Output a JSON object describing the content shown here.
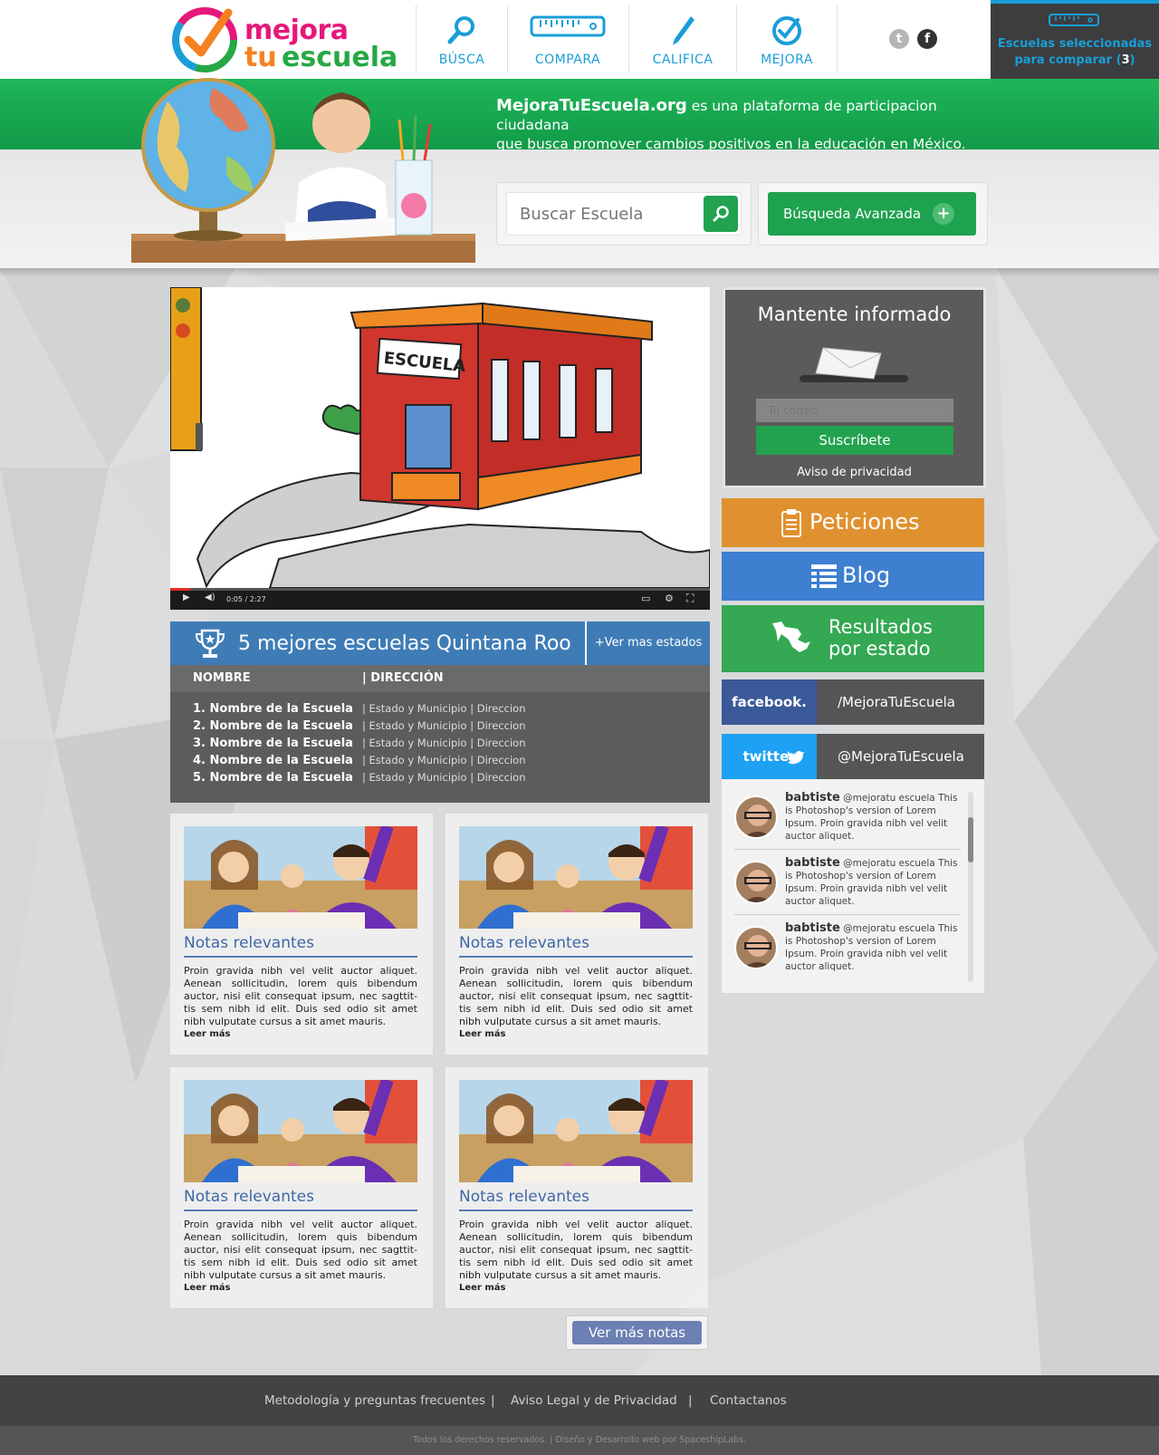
{
  "header": {
    "logo_line1": "mejora",
    "logo_line2a": "tu",
    "logo_line2b": "escuela",
    "nav": [
      {
        "label": "BÚSCA",
        "icon": "magnifier-icon"
      },
      {
        "label": "COMPARA",
        "icon": "ruler-icon"
      },
      {
        "label": "CALIFICA",
        "icon": "pencil-icon"
      },
      {
        "label": "MEJORA",
        "icon": "checkmark-icon"
      }
    ],
    "social": [
      {
        "icon": "twitter-icon",
        "glyph": "t"
      },
      {
        "icon": "facebook-icon",
        "glyph": "f"
      }
    ],
    "compare_line1": "Escuelas seleccionadas",
    "compare_line2": "para comparar (",
    "compare_count": "3",
    "compare_close": ")"
  },
  "hero": {
    "site_name": "MejoraTuEscuela.org",
    "tagline_rest": " es una plataforma de participacion ciudadana",
    "tagline_line2": "que busca promover cambios positivos en la educación en México.",
    "search_placeholder": "Buscar Escuela",
    "advanced_label": "Búsqueda Avanzada",
    "advanced_plus": "+"
  },
  "video": {
    "building_sign": "ESCUELA",
    "time": "0:05 / 2:27",
    "progress": 0.037
  },
  "ranking": {
    "title": "5 mejores escuelas Quintana Roo",
    "more_label": "+Ver  mas estados",
    "col_name": "NOMBRE",
    "col_address": "| DIRECCIÓN",
    "rows": [
      {
        "name": "1. Nombre de la Escuela",
        "address": "| Estado y Municipio | Direccion"
      },
      {
        "name": "2. Nombre de la Escuela",
        "address": "| Estado y Municipio | Direccion"
      },
      {
        "name": "3. Nombre de la Escuela",
        "address": "| Estado y Municipio | Direccion"
      },
      {
        "name": "4. Nombre de la Escuela",
        "address": "| Estado y Municipio | Direccion"
      },
      {
        "name": "5. Nombre de la Escuela",
        "address": "| Estado y Municipio | Direccion"
      }
    ]
  },
  "notes": [
    {
      "title": "Notas relevantes",
      "body": "Proin gravida nibh vel velit auctor aliquet. Aenean sollicitudin, lorem quis bibendum auctor, nisi elit consequat ipsum, nec sagttit-tis sem nibh id elit. Duis sed odio sit amet nibh vulputate cursus a sit amet mauris.",
      "more": "Leer más"
    },
    {
      "title": "Notas relevantes",
      "body": "Proin gravida nibh vel velit auctor aliquet. Aenean sollicitudin, lorem quis bibendum auctor, nisi elit consequat ipsum, nec sagttit-tis sem nibh id elit. Duis sed odio sit amet nibh vulputate cursus a sit amet mauris.",
      "more": "Leer más"
    },
    {
      "title": "Notas relevantes",
      "body": "Proin gravida nibh vel velit auctor aliquet. Aenean sollicitudin, lorem quis bibendum auctor, nisi elit consequat ipsum, nec sagttit-tis sem nibh id elit. Duis sed odio sit amet nibh vulputate cursus a sit amet mauris.",
      "more": "Leer más"
    },
    {
      "title": "Notas relevantes",
      "body": "Proin gravida nibh vel velit auctor aliquet. Aenean sollicitudin, lorem quis bibendum auctor, nisi elit consequat ipsum, nec sagttit-tis sem nibh id elit. Duis sed odio sit amet nibh vulputate cursus a sit amet mauris.",
      "more": "Leer más"
    }
  ],
  "more_notes_label": "Ver más notas",
  "sidebar": {
    "newsletter_title": "Mantente informado",
    "email_placeholder": "Tu correo",
    "subscribe_label": "Suscríbete",
    "privacy_label": "Aviso de privacidad",
    "petitions_label": "Peticiones",
    "blog_label": "Blog",
    "results_line1": "Resultados",
    "results_line2": "por estado",
    "facebook_brand": "facebook.",
    "facebook_handle": "/MejoraTuEscuela",
    "twitter_brand": "twitter",
    "twitter_handle": "@MejoraTuEscuela",
    "tweets": [
      {
        "user": "babtiste",
        "text": " @mejoratu escuela This is Photoshop's version  of Lorem Ipsum. Proin gravida nibh vel velit auctor aliquet."
      },
      {
        "user": "babtiste",
        "text": " @mejoratu escuela This is Photoshop's version  of Lorem Ipsum. Proin gravida nibh vel velit auctor aliquet."
      },
      {
        "user": "babtiste",
        "text": " @mejoratu escuela This is Photoshop's version  of Lorem Ipsum. Proin gravida nibh vel velit auctor aliquet."
      }
    ]
  },
  "footer": {
    "links": [
      "Metodología y preguntas frecuentes",
      "Aviso Legal  y  de Privacidad",
      "Contactanos"
    ],
    "separator": "|",
    "copyright": "Todos los derechos reservados. | Diseño y Desarrollo web por SpaceshipLabs."
  },
  "colors": {
    "brand_green": "#1fa24f",
    "brand_blue": "#1a9ed8",
    "ranking_blue": "#3f7cb6",
    "petitions": "#e0912f",
    "blog": "#3e7fd0",
    "results": "#34a853",
    "facebook": "#3b5998",
    "twitter": "#1da1f2"
  }
}
